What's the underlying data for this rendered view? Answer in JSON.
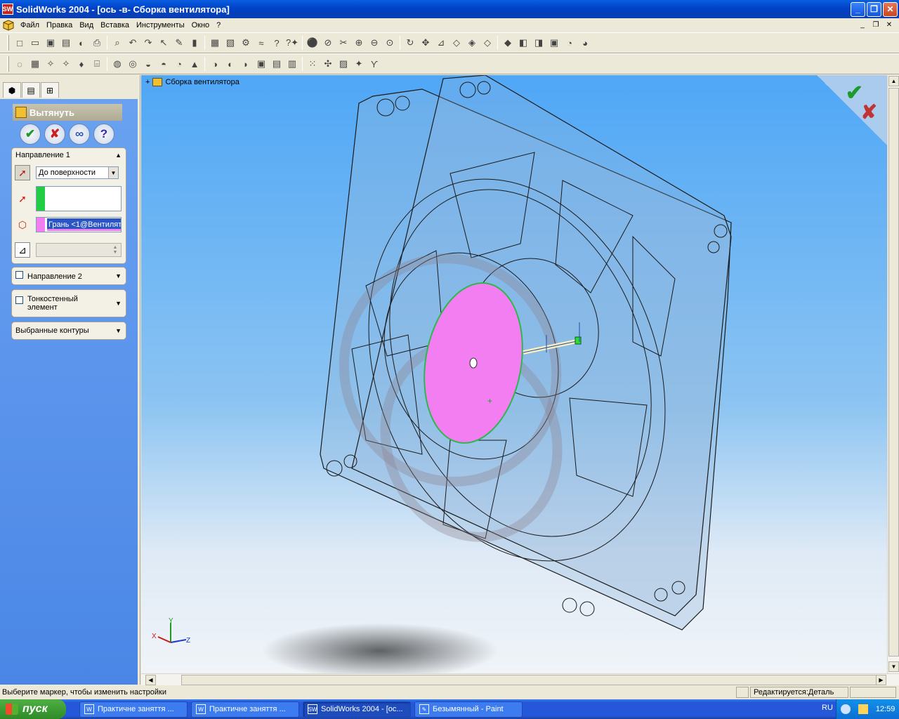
{
  "window": {
    "title": "SolidWorks 2004 - [ось -в- Сборка вентилятора]",
    "minimize": "_",
    "maximize": "❐",
    "close": "✕"
  },
  "menu": {
    "items": [
      "Файл",
      "Правка",
      "Вид",
      "Вставка",
      "Инструменты",
      "Окно",
      "?"
    ],
    "mdi": [
      "_",
      "❐",
      "✕"
    ]
  },
  "toolbar1": [
    "□",
    "▭",
    "▣",
    "▤",
    "◐",
    "⎙",
    "⌕",
    "↶",
    "↷",
    "↖",
    "✎",
    "▮",
    "▦",
    "▧",
    "⚙",
    "≈",
    "?",
    "?✦",
    "⚫",
    "⊘",
    "✂",
    "⊕",
    "⊖",
    "⊙",
    "↻",
    "✥",
    "⊿",
    "◇",
    "◈",
    "◇",
    "◆",
    "◧",
    "◨",
    "▣",
    "◔",
    "◕"
  ],
  "toolbar2": [
    "◌",
    "▦",
    "✧",
    "✧",
    "♦",
    "⌸",
    "◍",
    "◎",
    "◒",
    "◓",
    "◔",
    "▲",
    "◑",
    "◐",
    "◗",
    "▣",
    "▤",
    "▥",
    "⁙",
    "✣",
    "▨",
    "✦",
    "ϒ"
  ],
  "tabs": {
    "feature": "feature-tree",
    "property": "property-manager",
    "config": "configuration-manager"
  },
  "property_manager": {
    "title": "Вытянуть",
    "ok": "✔",
    "cancel": "✘",
    "preview": "∞",
    "help": "?",
    "direction1": {
      "label": "Направление 1",
      "end_condition": "До поверхности",
      "face_selection": "Грань <1@Вентилят"
    },
    "direction2": {
      "label": "Направление 2"
    },
    "thin": {
      "label": "Тонкостенный элемент"
    },
    "contours": {
      "label": "Выбранные контуры"
    }
  },
  "viewport": {
    "tree_root": "Сборка вентилятора",
    "expand": "+",
    "ok": "✔",
    "cancel": "✘",
    "triad": {
      "x": "X",
      "y": "Y",
      "z": "Z"
    }
  },
  "colors": {
    "face_highlight": "#f27ef2",
    "selection_green": "#22cc44",
    "viewport_top": "#4fa7f6",
    "viewport_bottom": "#f0f4f8"
  },
  "status": {
    "hint": "Выберите маркер, чтобы изменить настройки",
    "mode": "Редактируется:Деталь"
  },
  "taskbar": {
    "start": "пуск",
    "tasks": [
      {
        "label": "Практичне заняття ...",
        "icon": "W",
        "active": false
      },
      {
        "label": "Практичне заняття ...",
        "icon": "W",
        "active": false
      },
      {
        "label": "SolidWorks 2004 - [ос...",
        "icon": "SW",
        "active": true
      },
      {
        "label": "Безымянный - Paint",
        "icon": "✎",
        "active": false
      }
    ],
    "lang": "RU",
    "clock": "12:59"
  }
}
